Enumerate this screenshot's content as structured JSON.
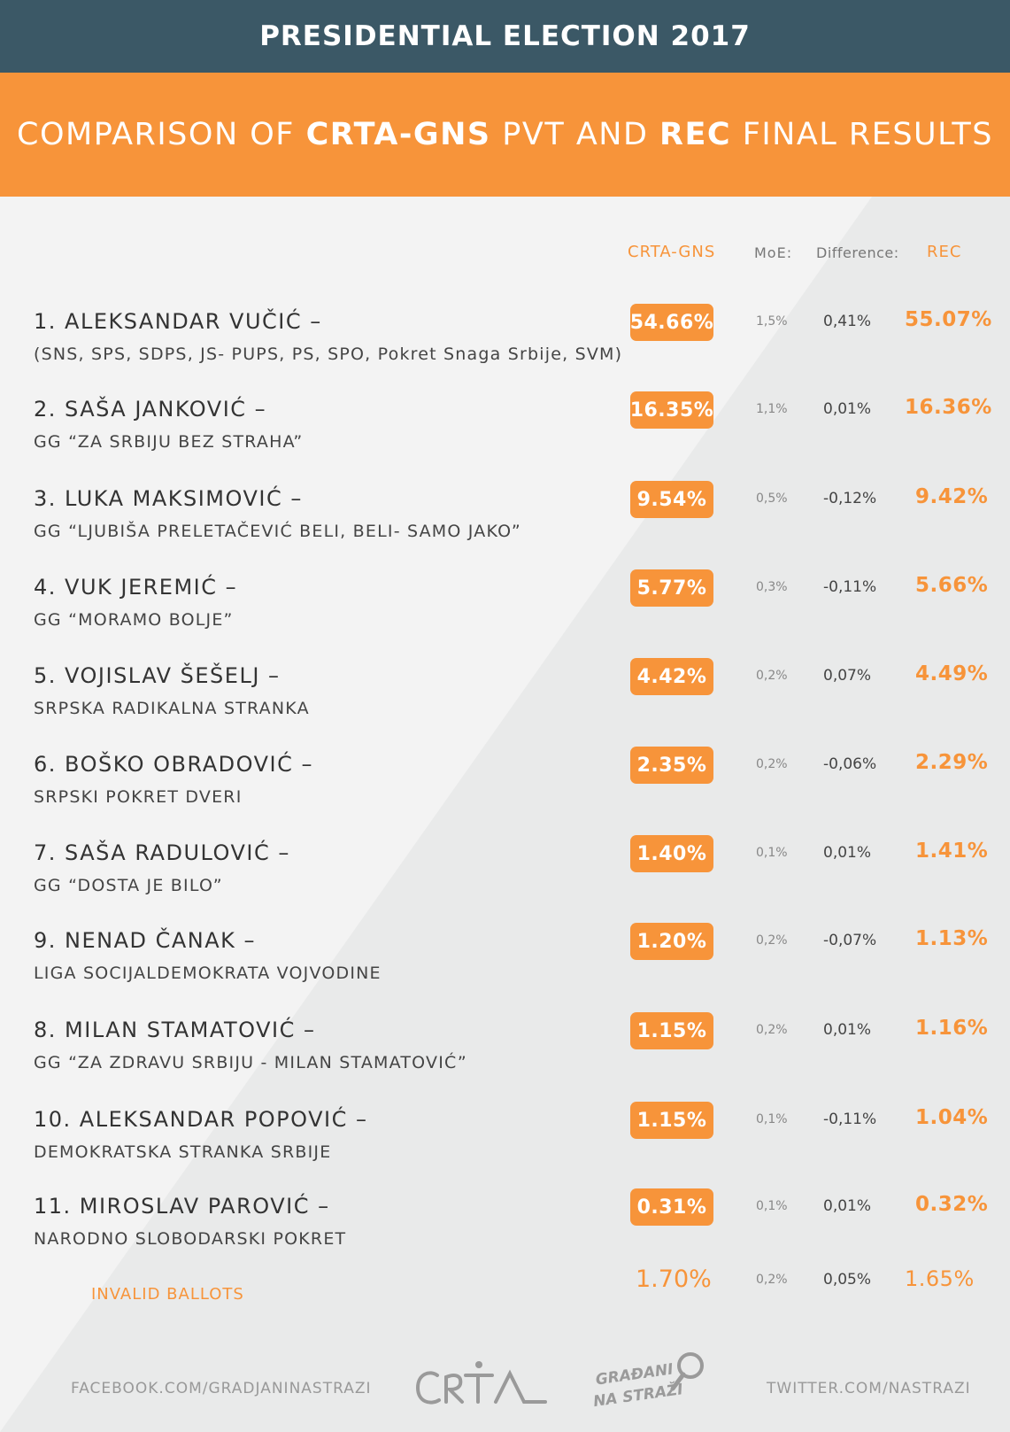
{
  "header": {
    "title": "PRESIDENTIAL ELECTION 2017"
  },
  "subheader": {
    "part1": "COMPARISON OF ",
    "bold1": "CRTA-GNS",
    "part2": " PVT AND ",
    "bold2": "REC",
    "part3": " FINAL RESULTS"
  },
  "columns": {
    "pvt": "CRTA-GNS",
    "moe": "MoE:",
    "diff": "Difference:",
    "rec": "REC"
  },
  "rows": [
    {
      "candidate": "1. ALEKSANDAR VUČIĆ –",
      "party": "(SNS, SPS, SDPS, JS- PUPS, PS, SPO, Pokret Snaga Srbije, SVM)",
      "pvt": "54.66%",
      "moe": "1,5%",
      "diff": "0,41%",
      "rec": "55.07%"
    },
    {
      "candidate": "2. SAŠA JANKOVIĆ –",
      "party": "GG “ZA SRBIJU BEZ STRAHA”",
      "pvt": "16.35%",
      "moe": "1,1%",
      "diff": "0,01%",
      "rec": "16.36%"
    },
    {
      "candidate": "3. LUKA MAKSIMOVIĆ –",
      "party": "GG “LJUBIŠA PRELETAČEVIĆ BELI, BELI- SAMO JAKO”",
      "pvt": "9.54%",
      "moe": "0,5%",
      "diff": "-0,12%",
      "rec": "9.42%"
    },
    {
      "candidate": "4. VUK JEREMIĆ –",
      "party": "GG “MORAMO BOLJE”",
      "pvt": "5.77%",
      "moe": "0,3%",
      "diff": "-0,11%",
      "rec": "5.66%"
    },
    {
      "candidate": "5. VOJISLAV ŠEŠELJ –",
      "party": "SRPSKA RADIKALNA STRANKA",
      "pvt": "4.42%",
      "moe": "0,2%",
      "diff": "0,07%",
      "rec": "4.49%"
    },
    {
      "candidate": "6. BOŠKO OBRADOVIĆ –",
      "party": "SRPSKI POKRET DVERI",
      "pvt": "2.35%",
      "moe": "0,2%",
      "diff": "-0,06%",
      "rec": "2.29%"
    },
    {
      "candidate": "7. SAŠA RADULOVIĆ –",
      "party": "GG “DOSTA JE BILO”",
      "pvt": "1.40%",
      "moe": "0,1%",
      "diff": "0,01%",
      "rec": "1.41%"
    },
    {
      "candidate": "9. NENAD ČANAK –",
      "party": "LIGA SOCIJALDEMOKRATA VOJVODINE",
      "pvt": "1.20%",
      "moe": "0,2%",
      "diff": "-0,07%",
      "rec": "1.13%"
    },
    {
      "candidate": "8. MILAN STAMATOVIĆ –",
      "party": "GG “ZA ZDRAVU SRBIJU - MILAN STAMATOVIĆ”",
      "pvt": "1.15%",
      "moe": "0,2%",
      "diff": "0,01%",
      "rec": "1.16%"
    },
    {
      "candidate": "10. ALEKSANDAR POPOVIĆ –",
      "party": "DEMOKRATSKA STRANKA SRBIJE",
      "pvt": "1.15%",
      "moe": "0,1%",
      "diff": "-0,11%",
      "rec": "1.04%"
    },
    {
      "candidate": "11. MIROSLAV PAROVIĆ –",
      "party": "NARODNO SLOBODARSKI POKRET",
      "pvt": "0.31%",
      "moe": "0,1%",
      "diff": "0,01%",
      "rec": "0.32%"
    }
  ],
  "invalid": {
    "label": "INVALID BALLOTS",
    "pvt": "1.70%",
    "moe": "0,2%",
    "diff": "0,05%",
    "rec": "1.65%"
  },
  "footer": {
    "facebook": "FACEBOOK.COM/GRADJANINASTRAZI",
    "twitter": "TWITTER.COM/NASTRAZI",
    "gns_line1": "GRAĐANI",
    "gns_line2": "NA STRAŽI"
  },
  "colors": {
    "orange": "#f7943a",
    "slate": "#3b5866"
  }
}
